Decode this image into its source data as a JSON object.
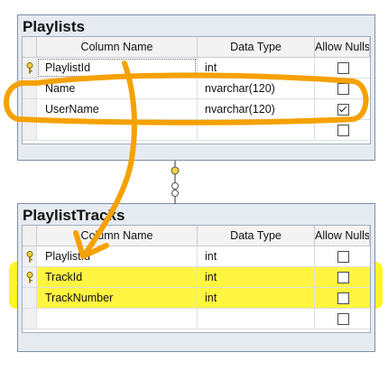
{
  "header": {
    "column_name": "Column Name",
    "data_type": "Data Type",
    "allow_nulls": "Allow Nulls"
  },
  "tables": [
    {
      "name": "Playlists",
      "rows": [
        {
          "column": "PlaylistId",
          "type": "int",
          "allow_nulls": false,
          "primary_key": true
        },
        {
          "column": "Name",
          "type": "nvarchar(120)",
          "allow_nulls": false,
          "primary_key": false
        },
        {
          "column": "UserName",
          "type": "nvarchar(120)",
          "allow_nulls": true,
          "primary_key": false
        }
      ]
    },
    {
      "name": "PlaylistTracks",
      "rows": [
        {
          "column": "PlaylistId",
          "type": "int",
          "allow_nulls": false,
          "primary_key": true
        },
        {
          "column": "TrackId",
          "type": "int",
          "allow_nulls": false,
          "primary_key": true
        },
        {
          "column": "TrackNumber",
          "type": "int",
          "allow_nulls": false,
          "primary_key": false
        }
      ]
    }
  ],
  "annotation_colors": {
    "orange": "#f5a100",
    "yellow": "#fff200"
  }
}
